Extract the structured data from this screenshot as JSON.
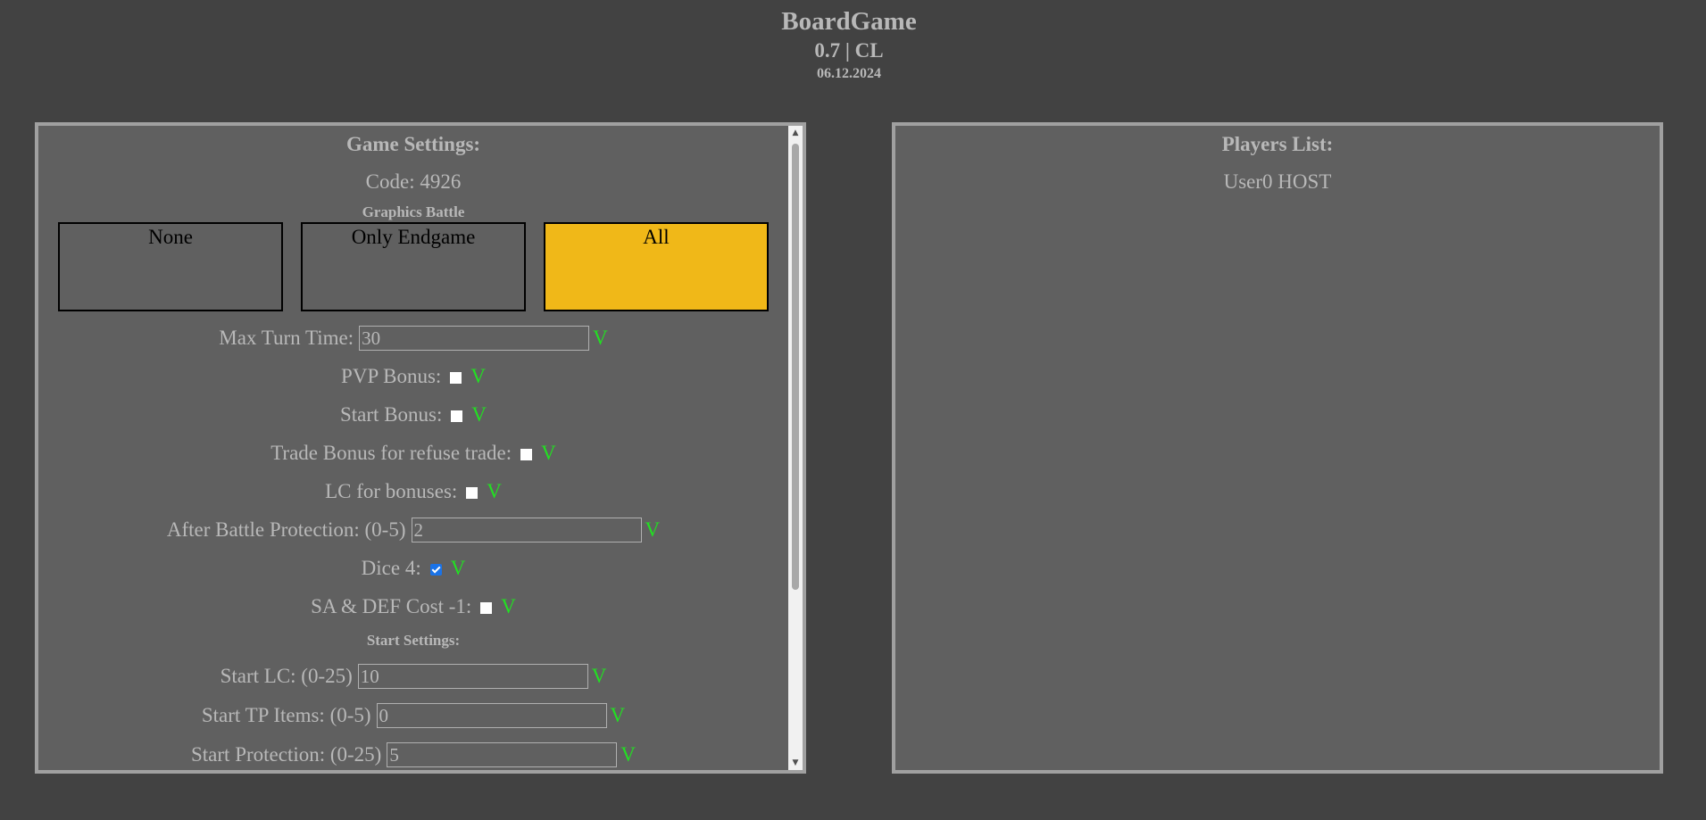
{
  "header": {
    "title": "BoardGame",
    "version": "0.7 | CL",
    "date": "06.12.2024"
  },
  "settings": {
    "title": "Game Settings:",
    "code": "Code: 4926",
    "graphics_label": "Graphics Battle",
    "graphics_options": [
      "None",
      "Only Endgame",
      "All"
    ],
    "graphics_selected": "All",
    "confirm_mark": "V",
    "max_turn_time": {
      "label": "Max Turn Time:",
      "value": "30"
    },
    "pvp_bonus": {
      "label": "PVP Bonus:",
      "checked": false
    },
    "start_bonus": {
      "label": "Start Bonus:",
      "checked": false
    },
    "trade_bonus": {
      "label": "Trade Bonus for refuse trade:",
      "checked": false
    },
    "lc_bonuses": {
      "label": "LC for bonuses:",
      "checked": false
    },
    "after_battle_protection": {
      "label": "After Battle Protection: (0-5)",
      "value": "2"
    },
    "dice4": {
      "label": "Dice 4:",
      "checked": true
    },
    "sa_def_cost": {
      "label": "SA & DEF Cost -1:",
      "checked": false
    },
    "start_settings_label": "Start Settings:",
    "start_lc": {
      "label": "Start LC: (0-25)",
      "value": "10"
    },
    "start_tp_items": {
      "label": "Start TP Items: (0-5)",
      "value": "0"
    },
    "start_protection": {
      "label": "Start Protection: (0-25)",
      "value": "5"
    }
  },
  "players": {
    "title": "Players List:",
    "items": [
      "User0 HOST"
    ]
  },
  "colors": {
    "background": "#424242",
    "panel": "#606060",
    "selected": "#f0b818",
    "confirm": "#22e022"
  }
}
